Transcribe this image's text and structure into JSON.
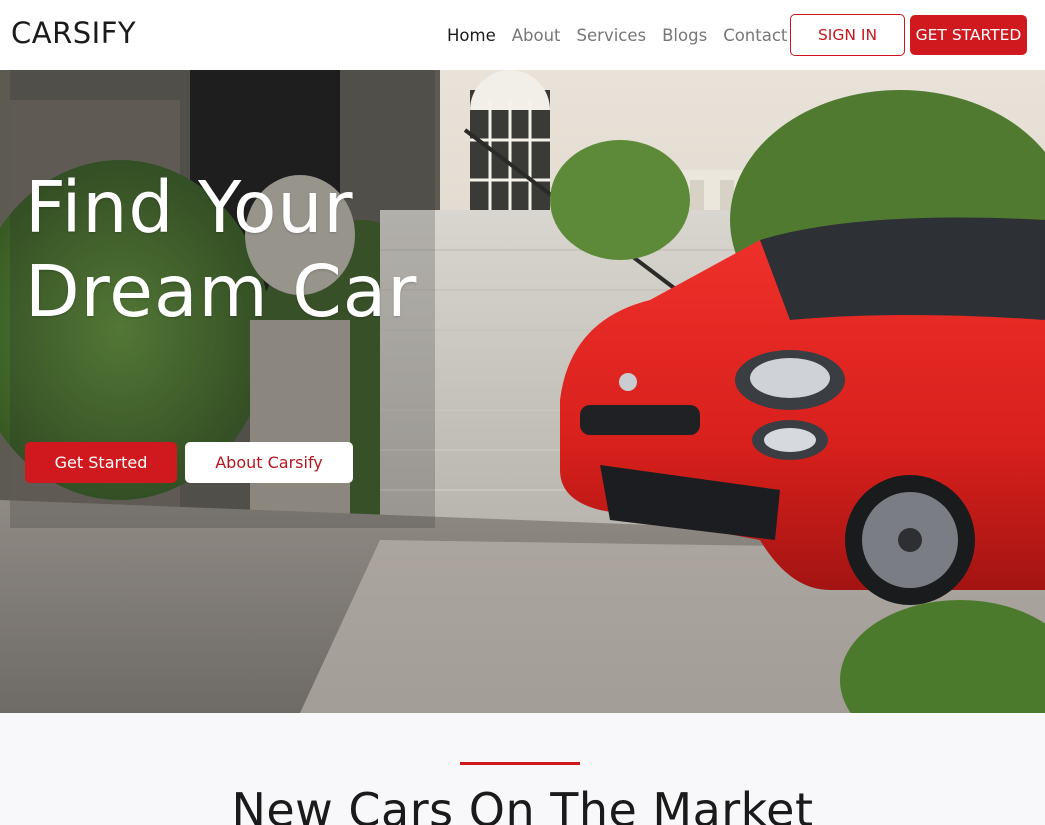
{
  "navbar": {
    "brand": "CARSIFY",
    "links": [
      {
        "label": "Home",
        "active": true
      },
      {
        "label": "About",
        "active": false
      },
      {
        "label": "Services",
        "active": false
      },
      {
        "label": "Blogs",
        "active": false
      },
      {
        "label": "Contact",
        "active": false
      }
    ],
    "sign_in_label": "SIGN IN",
    "get_started_label": "GET STARTED"
  },
  "hero": {
    "title_line1": "Find Your",
    "title_line2": "Dream Car",
    "primary_button": "Get Started",
    "secondary_button": "About Carsify",
    "image_description_icon": "red-car-photo"
  },
  "section": {
    "title": "New Cars On The Market"
  },
  "colors": {
    "accent": "#d0191f",
    "section_bg": "#f8f8fa",
    "nav_text": "#777777"
  }
}
